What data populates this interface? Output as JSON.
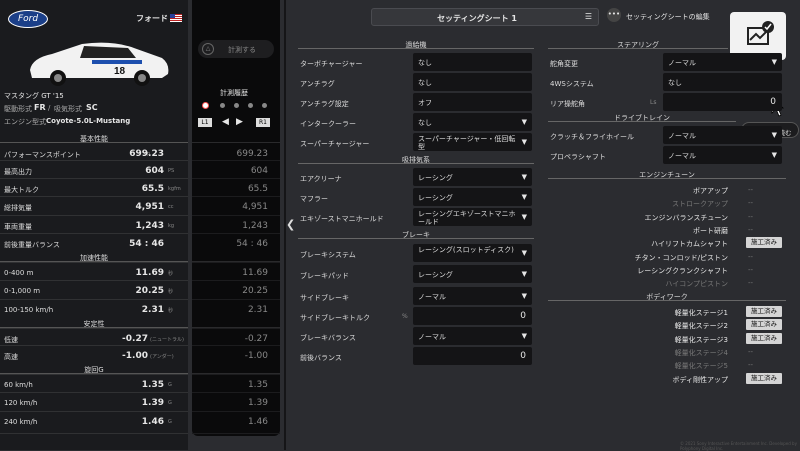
{
  "car": {
    "brand": "Ford",
    "maker": "フォード",
    "name": "マスタング GT '15",
    "drive_label": "駆動形式",
    "drive": "FR",
    "intake_label": "吸気形式",
    "intake": "SC",
    "engine_label": "エンジン型式",
    "engine": "Coyote-5.0L-Mustang",
    "number": "18"
  },
  "measure": {
    "button": "計測する",
    "history": "計測履歴",
    "l1": "L1",
    "r1": "R1"
  },
  "sections": {
    "basic": "基本性能",
    "accel": "加速性能",
    "stability": "安定性",
    "turn": "旋回G"
  },
  "stats": [
    {
      "label": "パフォーマンスポイント",
      "prefix": "PP",
      "value": "699.23",
      "unit": "",
      "cmp": "699.23"
    },
    {
      "label": "最高出力",
      "value": "604",
      "unit": "PS",
      "cmp": "604"
    },
    {
      "label": "最大トルク",
      "value": "65.5",
      "unit": "kgfm",
      "cmp": "65.5"
    },
    {
      "label": "総排気量",
      "value": "4,951",
      "unit": "cc",
      "cmp": "4,951"
    },
    {
      "label": "車両重量",
      "value": "1,243",
      "unit": "kg",
      "cmp": "1,243"
    },
    {
      "label": "前後重量バランス",
      "value": "54 : 46",
      "unit": "",
      "cmp": "54 : 46"
    },
    {
      "label": "0-400 m",
      "value": "11.69",
      "unit": "秒",
      "cmp": "11.69"
    },
    {
      "label": "0-1,000 m",
      "value": "20.25",
      "unit": "秒",
      "cmp": "20.25"
    },
    {
      "label": "100-150 km/h",
      "value": "2.31",
      "unit": "秒",
      "cmp": "2.31"
    },
    {
      "label": "低速",
      "value": "-0.27",
      "unit": "(ニュートラル)",
      "cmp": "-0.27"
    },
    {
      "label": "高速",
      "value": "-1.00",
      "unit": "(アンダー)",
      "cmp": "-1.00"
    },
    {
      "label": "60 km/h",
      "value": "1.35",
      "unit": "G",
      "cmp": "1.35"
    },
    {
      "label": "120 km/h",
      "value": "1.39",
      "unit": "G",
      "cmp": "1.39"
    },
    {
      "label": "240 km/h",
      "value": "1.46",
      "unit": "G",
      "cmp": "1.46"
    }
  ],
  "header": {
    "sheet": "セッティングシート 1",
    "edit": "セッティングシートの編集",
    "explain": "解説を読む"
  },
  "left_col": {
    "sec_forced": "過給機",
    "turbo": {
      "label": "ターボチャージャー",
      "value": "なし"
    },
    "antilag": {
      "label": "アンチラグ",
      "value": "なし"
    },
    "antilag_set": {
      "label": "アンチラグ設定",
      "value": "オフ"
    },
    "intercooler": {
      "label": "インタークーラー",
      "value": "なし"
    },
    "supercharger": {
      "label": "スーパーチャージャー",
      "value": "スーパーチャージャー・低回転型"
    },
    "sec_intake": "吸排気系",
    "air": {
      "label": "エアクリーナ",
      "value": "レーシング"
    },
    "muffler": {
      "label": "マフラー",
      "value": "レーシング"
    },
    "exhaust": {
      "label": "エキゾーストマニホールド",
      "value": "レーシングエキゾーストマニホールド"
    },
    "sec_brake": "ブレーキ",
    "brake_sys": {
      "label": "ブレーキシステム",
      "value": "レーシング(スロットディスク)"
    },
    "brake_pad": {
      "label": "ブレーキパッド",
      "value": "レーシング"
    },
    "side_brake": {
      "label": "サイドブレーキ",
      "value": "ノーマル"
    },
    "side_torque": {
      "label": "サイドブレーキトルク",
      "unit": "%",
      "value": "0"
    },
    "brake_bal": {
      "label": "ブレーキバランス",
      "value": "ノーマル"
    },
    "fr_bal": {
      "label": "前後バランス",
      "value": "0"
    }
  },
  "right_col": {
    "sec_steer": "ステアリング",
    "steer": {
      "label": "舵角変更",
      "value": "ノーマル"
    },
    "ws4": {
      "label": "4WSシステム",
      "value": "なし"
    },
    "rear": {
      "label": "リア操舵角",
      "unit": "Ls",
      "value": "0"
    },
    "sec_drive": "ドライブトレイン",
    "clutch": {
      "label": "クラッチ＆フライホイール",
      "value": "ノーマル"
    },
    "prop": {
      "label": "プロペラシャフト",
      "value": "ノーマル"
    },
    "sec_tune": "エンジンチューン",
    "tune": [
      {
        "label": "ボアアップ",
        "value": "--",
        "badge": false,
        "dim": false
      },
      {
        "label": "ストロークアップ",
        "value": "--",
        "badge": false,
        "dim": true
      },
      {
        "label": "エンジンバランスチューン",
        "value": "--",
        "badge": false,
        "dim": false
      },
      {
        "label": "ポート研磨",
        "value": "--",
        "badge": false,
        "dim": false
      },
      {
        "label": "ハイリフトカムシャフト",
        "value": "施工済み",
        "badge": true,
        "dim": false
      },
      {
        "label": "チタン・コンロッド/ピストン",
        "value": "--",
        "badge": false,
        "dim": false
      },
      {
        "label": "レーシングクランクシャフト",
        "value": "--",
        "badge": false,
        "dim": false
      },
      {
        "label": "ハイコンプピストン",
        "value": "--",
        "badge": false,
        "dim": true
      }
    ],
    "sec_body": "ボディワーク",
    "body": [
      {
        "label": "軽量化ステージ1",
        "value": "施工済み",
        "badge": true,
        "dim": false
      },
      {
        "label": "軽量化ステージ2",
        "value": "施工済み",
        "badge": true,
        "dim": false
      },
      {
        "label": "軽量化ステージ3",
        "value": "施工済み",
        "badge": true,
        "dim": false
      },
      {
        "label": "軽量化ステージ4",
        "value": "--",
        "badge": false,
        "dim": true
      },
      {
        "label": "軽量化ステージ5",
        "value": "--",
        "badge": false,
        "dim": true
      },
      {
        "label": "ボディ剛性アップ",
        "value": "施工済み",
        "badge": true,
        "dim": false
      }
    ]
  },
  "footer": "© 2021 Sony Interactive Entertainment Inc. Developed by Polyphony Digital Inc."
}
